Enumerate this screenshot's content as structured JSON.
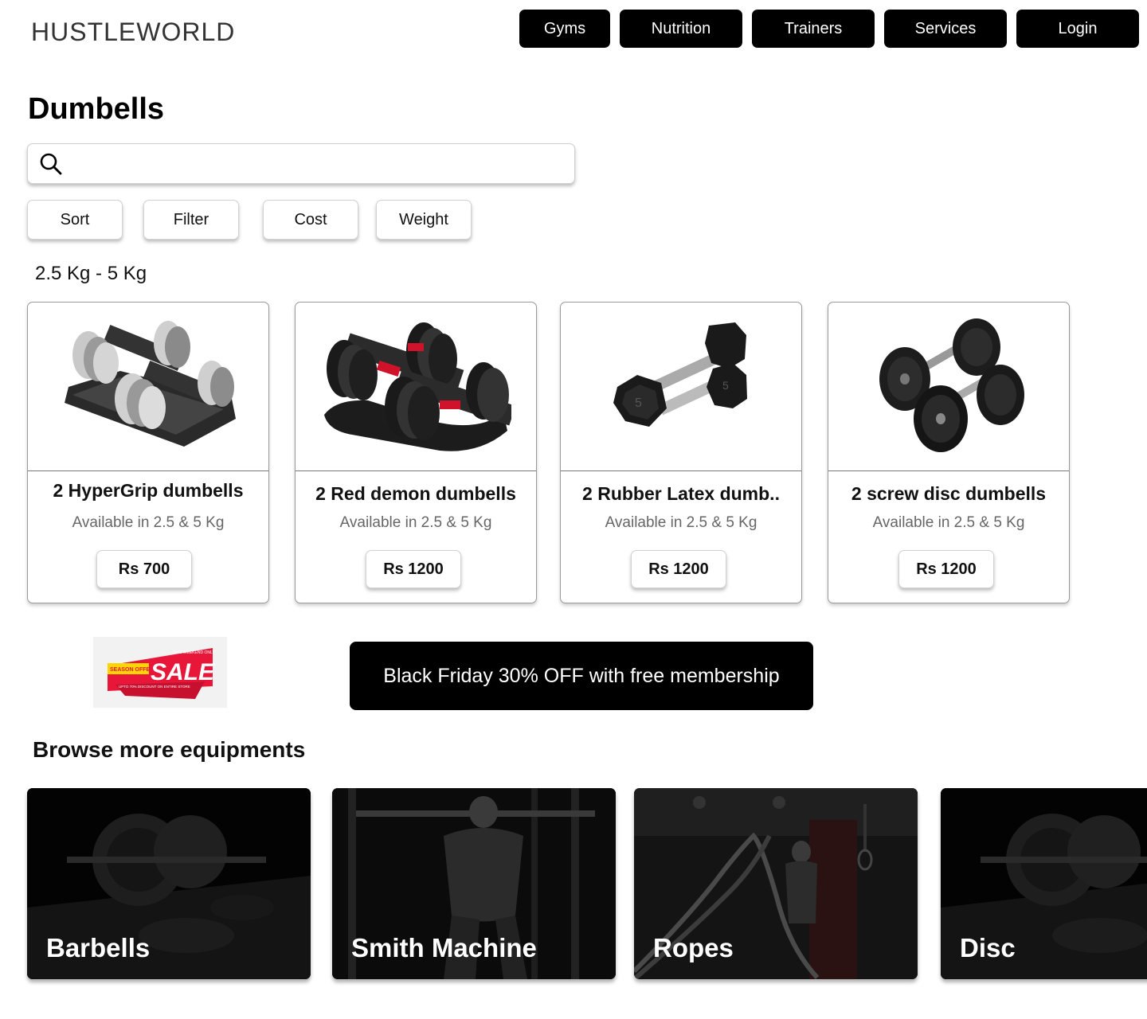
{
  "header": {
    "brand": "HUSTLEWORLD",
    "nav": [
      "Gyms",
      "Nutrition",
      "Trainers",
      "Services",
      "Login"
    ]
  },
  "page_title": "Dumbells",
  "search": {
    "placeholder": "",
    "icon": "search-icon"
  },
  "chips": [
    "Sort",
    "Filter",
    "Cost",
    "Weight"
  ],
  "section_label": "2.5 Kg - 5  Kg",
  "products": [
    {
      "name": "2 HyperGrip dumbells",
      "availability": "Available in 2.5 & 5 Kg",
      "price": "Rs 700"
    },
    {
      "name": "2 Red demon dumbells",
      "availability": "Available in 2.5 & 5 Kg",
      "price": "Rs 1200"
    },
    {
      "name": "2 Rubber Latex dumb..",
      "availability": "Available in 2.5 & 5 Kg",
      "price": "Rs 1200"
    },
    {
      "name": "2 screw disc dumbells",
      "availability": "Available in 2.5 & 5 Kg",
      "price": "Rs 1200"
    }
  ],
  "sale_banner": {
    "main": "SALE",
    "tag": "SEASON OFFER",
    "top": "THIS WEEKEND ONLY",
    "sub": "UPTO 70% DISCOUNT ON ENTIRE STORE"
  },
  "promo": "Black Friday 30% OFF with free membership",
  "browse_title": "Browse more equipments",
  "categories": [
    "Barbells",
    "Smith Machine",
    "Ropes",
    "Disc"
  ],
  "colors": {
    "nav_bg": "#000000",
    "promo_bg": "#000000",
    "sale_red": "#e8173a",
    "sale_yellow": "#ffd500"
  }
}
